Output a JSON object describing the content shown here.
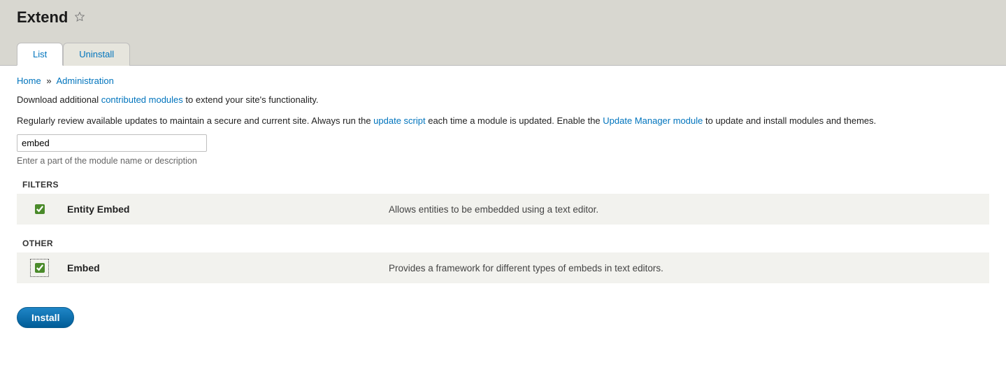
{
  "header": {
    "title": "Extend",
    "tabs": {
      "list": "List",
      "uninstall": "Uninstall"
    }
  },
  "breadcrumb": {
    "home": "Home",
    "sep": "»",
    "admin": "Administration"
  },
  "help": {
    "line1_pre": "Download additional ",
    "line1_link": "contributed modules",
    "line1_post": " to extend your site's functionality.",
    "line2_pre": "Regularly review available updates to maintain a secure and current site. Always run the ",
    "line2_link1": "update script",
    "line2_mid": " each time a module is updated. Enable the ",
    "line2_link2": "Update Manager module",
    "line2_post": " to update and install modules and themes."
  },
  "filter": {
    "value": "embed",
    "description": "Enter a part of the module name or description"
  },
  "groups": {
    "filters": {
      "heading": "FILTERS",
      "rows": {
        "entity_embed": {
          "name": "Entity Embed",
          "description": "Allows entities to be embedded using a text editor."
        }
      }
    },
    "other": {
      "heading": "OTHER",
      "rows": {
        "embed": {
          "name": "Embed",
          "description": "Provides a framework for different types of embeds in text editors."
        }
      }
    }
  },
  "actions": {
    "install": "Install"
  }
}
